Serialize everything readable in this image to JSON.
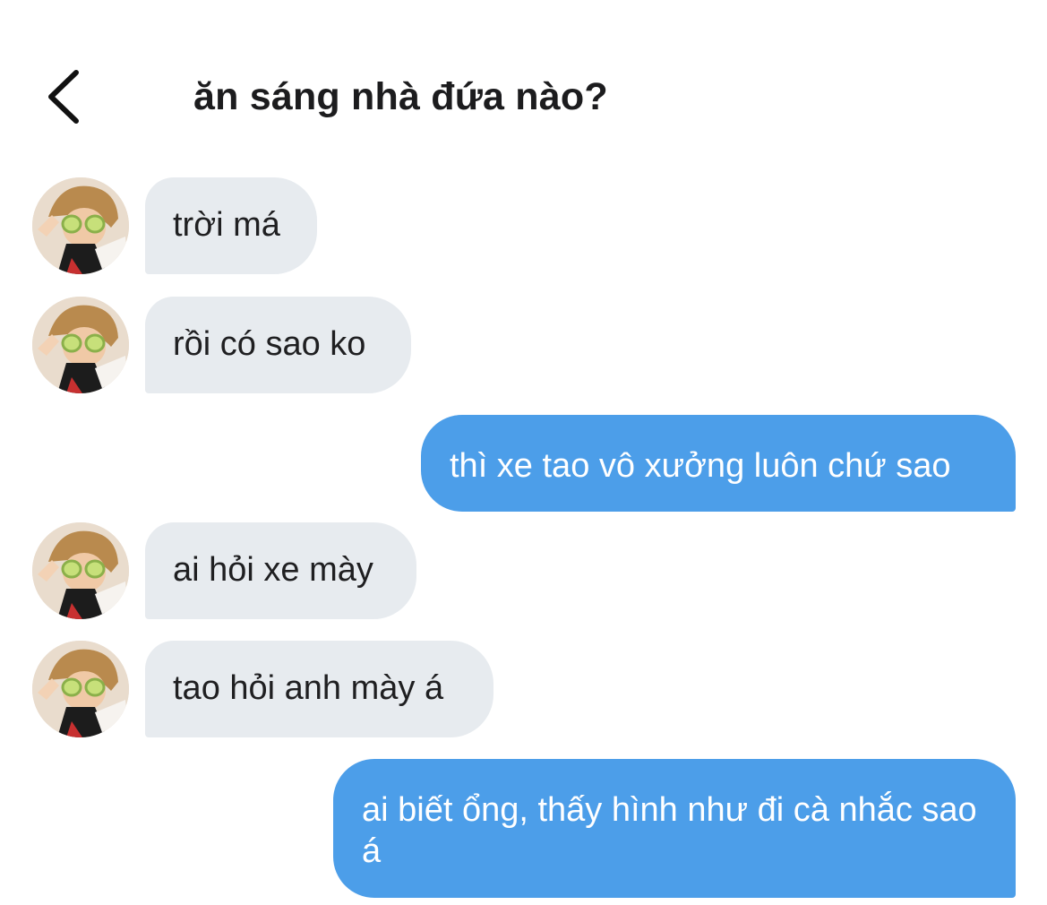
{
  "header": {
    "title": "ăn sáng nhà đứa nào?"
  },
  "messages": [
    {
      "sender": "other",
      "text": "trời má"
    },
    {
      "sender": "other",
      "text": "rồi có sao ko"
    },
    {
      "sender": "me",
      "text": "thì xe tao vô xưởng luôn chứ sao"
    },
    {
      "sender": "other",
      "text": "ai hỏi xe mày"
    },
    {
      "sender": "other",
      "text": "tao hỏi anh mày á"
    },
    {
      "sender": "me",
      "text": "ai biết ổng, thấy hình như đi cà nhắc sao á"
    }
  ],
  "colors": {
    "incoming_bubble": "#e7ebef",
    "outgoing_bubble": "#4c9ee9",
    "title_text": "#1c1c1e"
  }
}
